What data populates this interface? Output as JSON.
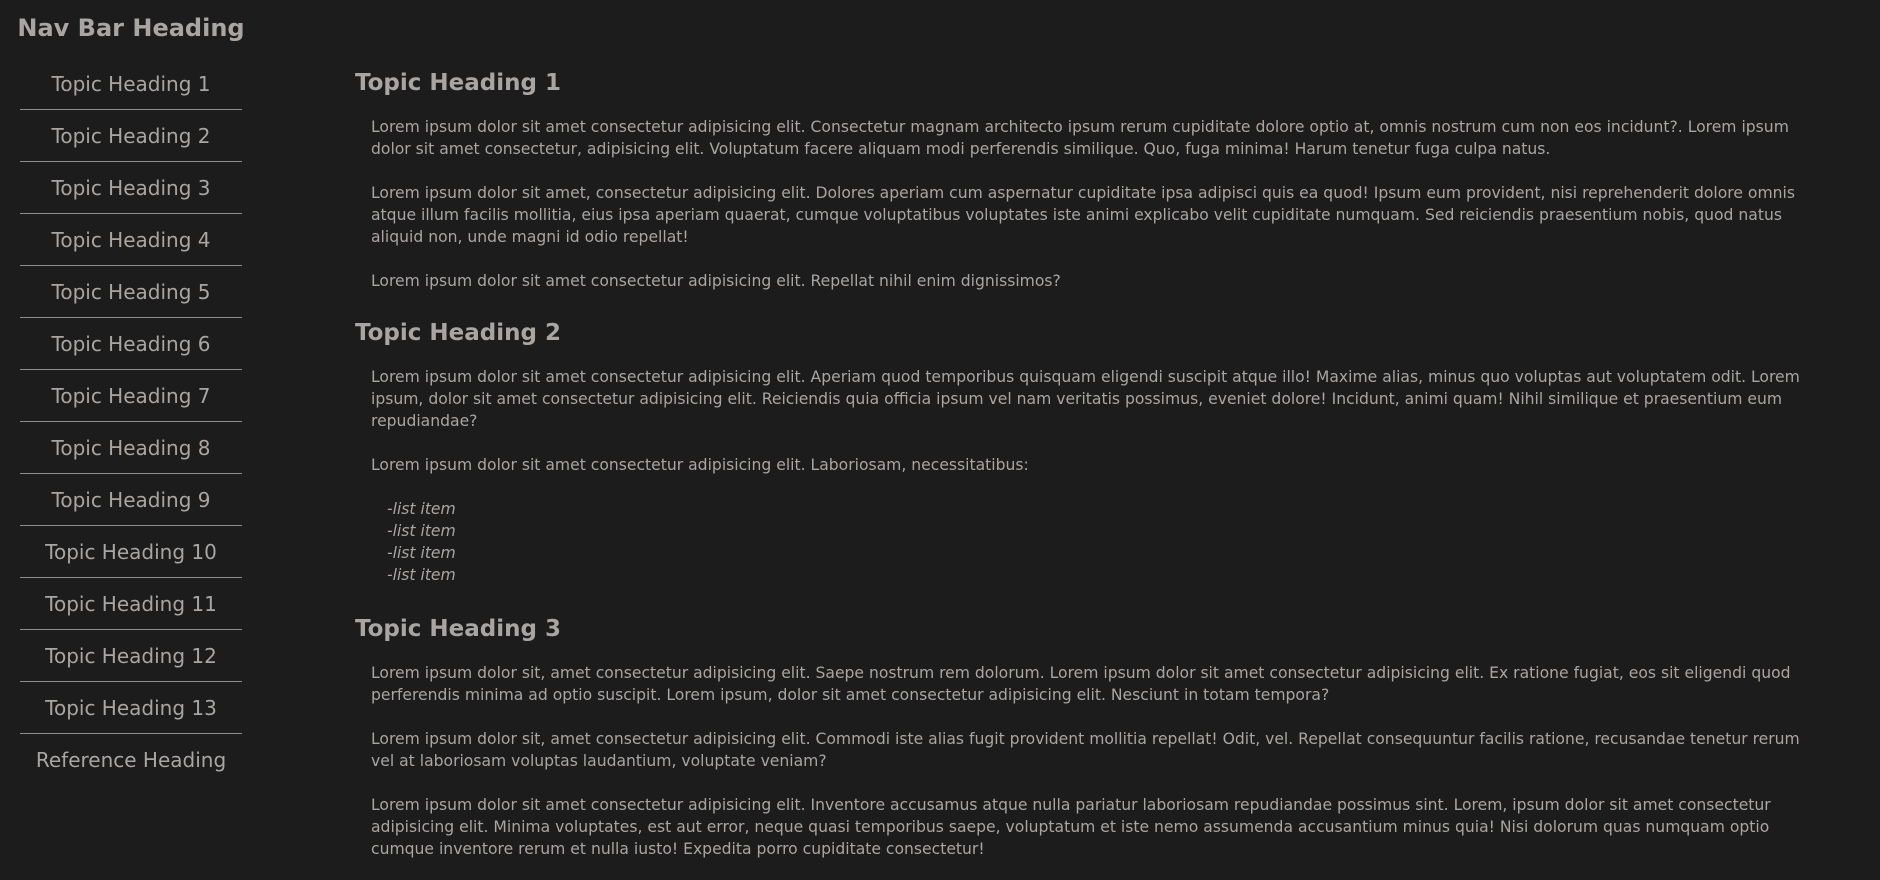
{
  "nav": {
    "heading": "Nav Bar Heading",
    "items": [
      {
        "label": "Topic Heading 1"
      },
      {
        "label": "Topic Heading 2"
      },
      {
        "label": "Topic Heading 3"
      },
      {
        "label": "Topic Heading 4"
      },
      {
        "label": "Topic Heading 5"
      },
      {
        "label": "Topic Heading 6"
      },
      {
        "label": "Topic Heading 7"
      },
      {
        "label": "Topic Heading 8"
      },
      {
        "label": "Topic Heading 9"
      },
      {
        "label": "Topic Heading 10"
      },
      {
        "label": "Topic Heading 11"
      },
      {
        "label": "Topic Heading 12"
      },
      {
        "label": "Topic Heading 13"
      },
      {
        "label": "Reference Heading"
      }
    ]
  },
  "sections": [
    {
      "heading": "Topic Heading 1",
      "paragraphs": [
        "Lorem ipsum dolor sit amet consectetur adipisicing elit. Consectetur magnam architecto ipsum rerum cupiditate dolore optio at, omnis nostrum cum non eos incidunt?. Lorem ipsum dolor sit amet consectetur, adipisicing elit. Voluptatum facere aliquam modi perferendis similique. Quo, fuga minima! Harum tenetur fuga culpa natus.",
        "Lorem ipsum dolor sit amet, consectetur adipisicing elit. Dolores aperiam cum aspernatur cupiditate ipsa adipisci quis ea quod! Ipsum eum provident, nisi reprehenderit dolore omnis atque illum facilis mollitia, eius ipsa aperiam quaerat, cumque voluptatibus voluptates iste animi explicabo velit cupiditate numquam. Sed reiciendis praesentium nobis, quod natus aliquid non, unde magni id odio repellat!",
        "Lorem ipsum dolor sit amet consectetur adipisicing elit. Repellat nihil enim dignissimos?"
      ]
    },
    {
      "heading": "Topic Heading 2",
      "paragraphs": [
        "Lorem ipsum dolor sit amet consectetur adipisicing elit. Aperiam quod temporibus quisquam eligendi suscipit atque illo! Maxime alias, minus quo voluptas aut voluptatem odit. Lorem ipsum, dolor sit amet consectetur adipisicing elit. Reiciendis quia officia ipsum vel nam veritatis possimus, eveniet dolore! Incidunt, animi quam! Nihil similique et praesentium eum repudiandae?",
        "Lorem ipsum dolor sit amet consectetur adipisicing elit. Laboriosam, necessitatibus:"
      ],
      "list": [
        "-list item",
        "-list item",
        "-list item",
        "-list item"
      ]
    },
    {
      "heading": "Topic Heading 3",
      "paragraphs": [
        "Lorem ipsum dolor sit, amet consectetur adipisicing elit. Saepe nostrum rem dolorum. Lorem ipsum dolor sit amet consectetur adipisicing elit. Ex ratione fugiat, eos sit eligendi quod perferendis minima ad optio suscipit. Lorem ipsum, dolor sit amet consectetur adipisicing elit. Nesciunt in totam tempora?",
        "Lorem ipsum dolor sit, amet consectetur adipisicing elit. Commodi iste alias fugit provident mollitia repellat! Odit, vel. Repellat consequuntur facilis ratione, recusandae tenetur rerum vel at laboriosam voluptas laudantium, voluptate veniam?",
        "Lorem ipsum dolor sit amet consectetur adipisicing elit. Inventore accusamus atque nulla pariatur laboriosam repudiandae possimus sint. Lorem, ipsum dolor sit amet consectetur adipisicing elit. Minima voluptates, est aut error, neque quasi temporibus saepe, voluptatum et iste nemo assumenda accusantium minus quia! Nisi dolorum quas numquam optio cumque inventore rerum et nulla iusto! Expedita porro cupiditate consectetur!"
      ]
    }
  ],
  "colors": {
    "background": "#1c1c1c",
    "text": "#a9a5a2",
    "divider": "#8f8b88"
  }
}
